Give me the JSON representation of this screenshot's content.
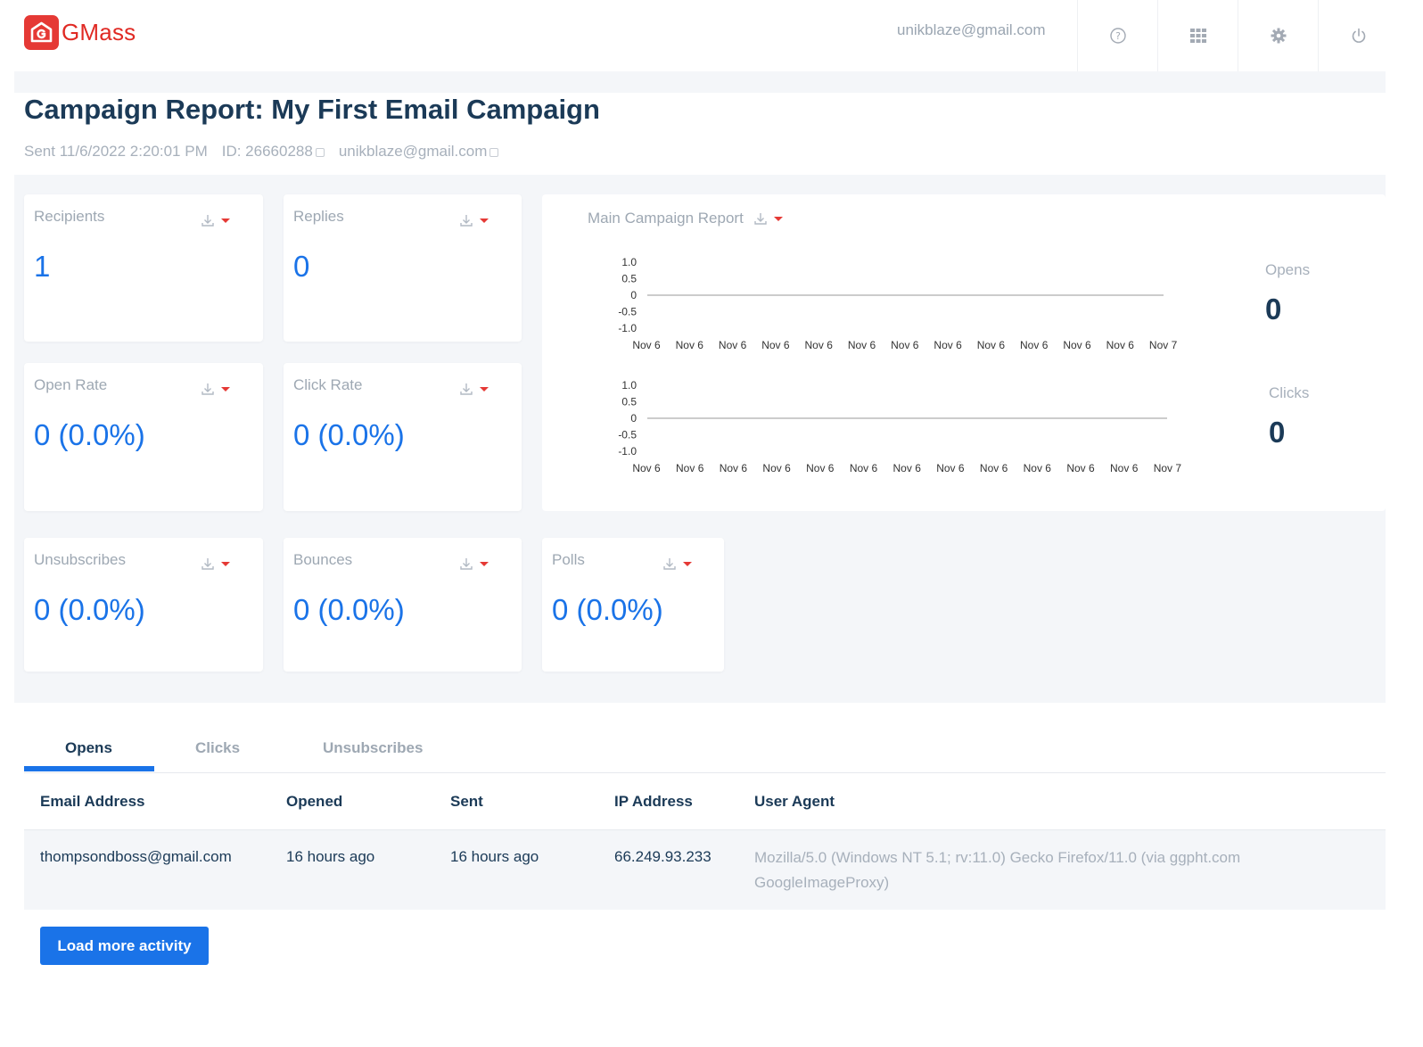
{
  "app": {
    "name": "GMass",
    "brand_color": "#e53935",
    "accent_color": "#1a73e8"
  },
  "header": {
    "user_email": "unikblaze@gmail.com",
    "icons": [
      "help-icon",
      "apps-grid-icon",
      "settings-gear-icon",
      "power-icon"
    ]
  },
  "report": {
    "title": "Campaign Report: My First Email Campaign",
    "sent": "Sent 11/6/2022 2:20:01 PM",
    "id": "ID: 26660288",
    "email": "unikblaze@gmail.com"
  },
  "stats": {
    "recipients": {
      "label": "Recipients",
      "value": "1"
    },
    "replies": {
      "label": "Replies",
      "value": "0"
    },
    "open_rate": {
      "label": "Open Rate",
      "value": "0 (0.0%)"
    },
    "click_rate": {
      "label": "Click Rate",
      "value": "0 (0.0%)"
    },
    "unsubscribes": {
      "label": "Unsubscribes",
      "value": "0 (0.0%)"
    },
    "bounces": {
      "label": "Bounces",
      "value": "0 (0.0%)"
    },
    "polls": {
      "label": "Polls",
      "value": "0 (0.0%)"
    }
  },
  "main_report": {
    "title": "Main Campaign Report",
    "opens_label": "Opens",
    "opens_value": "0",
    "clicks_label": "Clicks",
    "clicks_value": "0"
  },
  "chart_data": [
    {
      "type": "line",
      "title": "",
      "categories": [
        "Nov 6",
        "Nov 6",
        "Nov 6",
        "Nov 6",
        "Nov 6",
        "Nov 6",
        "Nov 6",
        "Nov 6",
        "Nov 6",
        "Nov 6",
        "Nov 6",
        "Nov 6",
        "Nov 7"
      ],
      "series": [
        {
          "values": [
            0,
            0,
            0,
            0,
            0,
            0,
            0,
            0,
            0,
            0,
            0,
            0,
            0
          ]
        }
      ],
      "yticks": [
        "1.0",
        "0.5",
        "0",
        "-0.5",
        "-1.0"
      ],
      "ylim": [
        -1.0,
        1.0
      ],
      "grid": false
    },
    {
      "type": "line",
      "title": "",
      "categories": [
        "Nov 6",
        "Nov 6",
        "Nov 6",
        "Nov 6",
        "Nov 6",
        "Nov 6",
        "Nov 6",
        "Nov 6",
        "Nov 6",
        "Nov 6",
        "Nov 6",
        "Nov 6",
        "Nov 7"
      ],
      "series": [
        {
          "values": [
            0,
            0,
            0,
            0,
            0,
            0,
            0,
            0,
            0,
            0,
            0,
            0,
            0
          ]
        }
      ],
      "yticks": [
        "1.0",
        "0.5",
        "0",
        "-0.5",
        "-1.0"
      ],
      "ylim": [
        -1.0,
        1.0
      ],
      "grid": false
    }
  ],
  "activity": {
    "tabs": [
      "Opens",
      "Clicks",
      "Unsubscribes"
    ],
    "active_tab": "Opens",
    "columns": [
      "Email Address",
      "Opened",
      "Sent",
      "IP Address",
      "User Agent"
    ],
    "rows": [
      {
        "email": "thompsondboss@gmail.com",
        "opened": "16 hours ago",
        "sent": "16 hours ago",
        "ip": "66.249.93.233",
        "user_agent": "Mozilla/5.0 (Windows NT 5.1; rv:11.0) Gecko Firefox/11.0 (via ggpht.com GoogleImageProxy)"
      }
    ],
    "load_more_label": "Load more activity"
  }
}
